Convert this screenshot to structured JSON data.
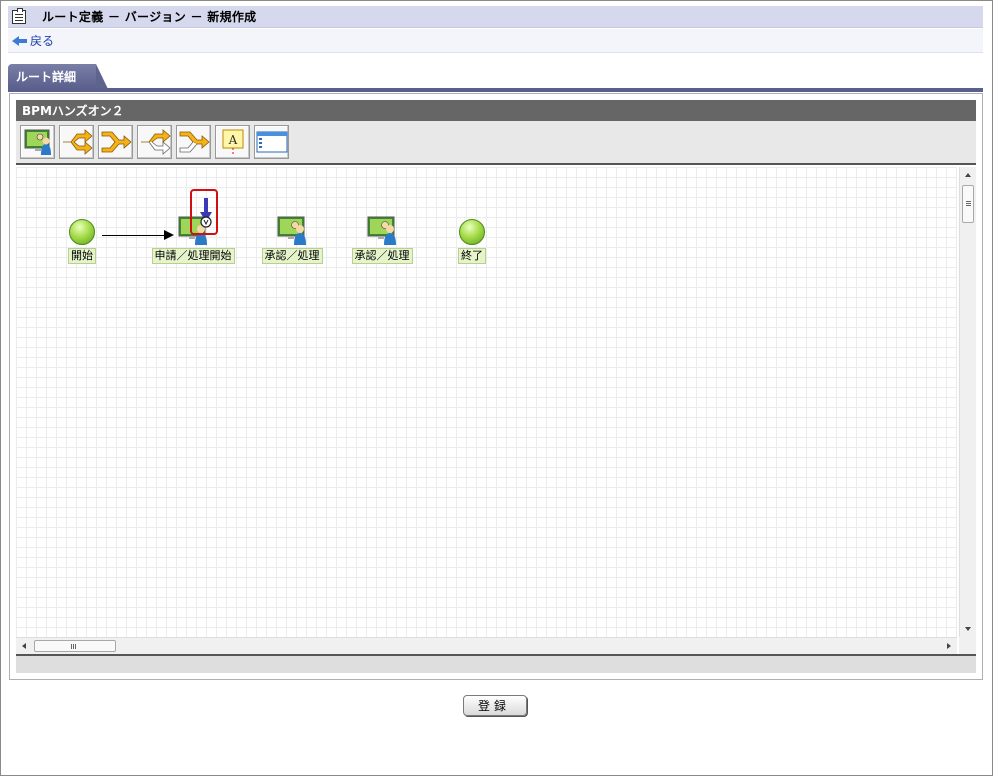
{
  "header": {
    "title": "ルート定義 － バージョン － 新規作成",
    "back_label": "戻る"
  },
  "tabs": [
    {
      "label": "ルート詳細",
      "active": true
    }
  ],
  "panel": {
    "title": "BPMハンズオン２"
  },
  "toolbar": {
    "buttons": [
      {
        "name": "user-task-tool",
        "icon": "monitor-user-icon"
      },
      {
        "name": "split-branch-tool",
        "icon": "split-arrow-icon"
      },
      {
        "name": "merge-branch-tool",
        "icon": "merge-arrow-icon"
      },
      {
        "name": "split-branch-outline-tool",
        "icon": "split-arrow-outline-icon"
      },
      {
        "name": "merge-branch-outline-tool",
        "icon": "merge-arrow-outline-icon"
      },
      {
        "name": "annotation-tool",
        "icon": "text-annotation-icon",
        "label": "A"
      },
      {
        "name": "form-tool",
        "icon": "window-form-icon"
      }
    ]
  },
  "nodes": [
    {
      "id": "start",
      "type": "start",
      "label": "開始"
    },
    {
      "id": "apply",
      "type": "task",
      "label": "申請／処理開始"
    },
    {
      "id": "approve1",
      "type": "task",
      "label": "承認／処理"
    },
    {
      "id": "approve2",
      "type": "task",
      "label": "承認／処理"
    },
    {
      "id": "end",
      "type": "end",
      "label": "終了"
    }
  ],
  "footer": {
    "submit_label": "登録"
  },
  "colors": {
    "header_bg": "#d6d9ee",
    "tab_bg": "#5a5f8c",
    "panel_header_bg": "#666666",
    "node_green": "#a6dc4a",
    "highlight": "#d01010"
  }
}
